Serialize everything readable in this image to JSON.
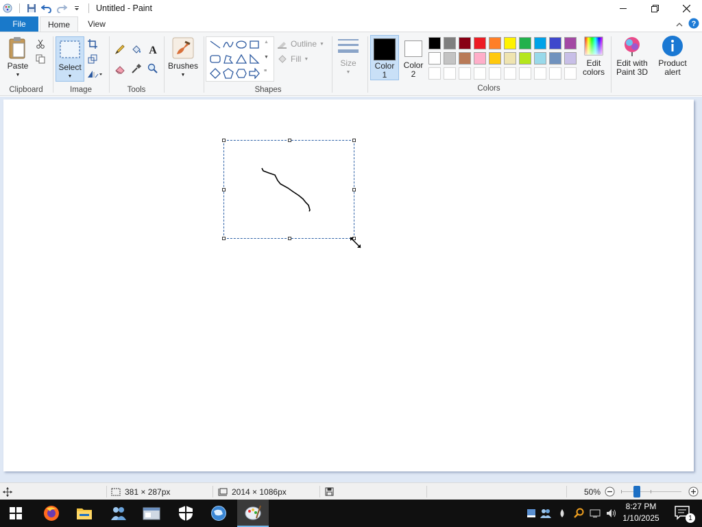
{
  "window": {
    "title": "Untitled - Paint"
  },
  "tabs": {
    "file": "File",
    "home": "Home",
    "view": "View"
  },
  "ribbon": {
    "clipboard": {
      "paste": "Paste",
      "label": "Clipboard"
    },
    "image": {
      "select": "Select",
      "label": "Image"
    },
    "tools": {
      "label": "Tools"
    },
    "brushes": {
      "label": "Brushes"
    },
    "shapes": {
      "outline": "Outline",
      "fill": "Fill",
      "label": "Shapes"
    },
    "size": {
      "label": "Size"
    },
    "color1": {
      "line1": "Color",
      "line2": "1"
    },
    "color2": {
      "line1": "Color",
      "line2": "2"
    },
    "colors_label": "Colors",
    "edit_colors": {
      "line1": "Edit",
      "line2": "colors"
    },
    "paint3d": {
      "line1": "Edit with",
      "line2": "Paint 3D"
    },
    "product_alert": {
      "line1": "Product",
      "line2": "alert"
    },
    "palette_row1": [
      "#000000",
      "#7f7f7f",
      "#880015",
      "#ed1c24",
      "#ff7f27",
      "#fff200",
      "#22b14c",
      "#00a2e8",
      "#3f48cc",
      "#a349a4"
    ],
    "palette_row2": [
      "#ffffff",
      "#c3c3c3",
      "#b97a57",
      "#ffaec9",
      "#ffc90e",
      "#efe4b0",
      "#b5e61d",
      "#99d9ea",
      "#7092be",
      "#c8bfe7"
    ]
  },
  "status": {
    "selection_size": "381 × 287px",
    "image_size": "2014 × 1086px",
    "zoom": "50%"
  },
  "taskbar": {
    "time": "8:27 PM",
    "date": "1/10/2025",
    "notification_count": "1"
  }
}
